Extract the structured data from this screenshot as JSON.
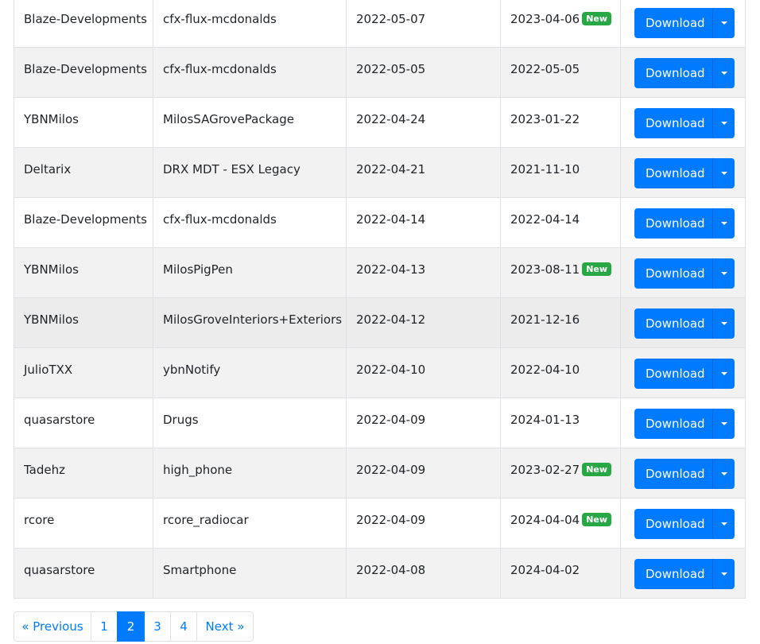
{
  "rows": [
    {
      "author": "Blaze-Developments",
      "name": "cfx-flux-mcdonalds",
      "created": "2022-05-07",
      "updated": "2023-04-06",
      "is_new": true
    },
    {
      "author": "Blaze-Developments",
      "name": "cfx-flux-mcdonalds",
      "created": "2022-05-05",
      "updated": "2022-05-05",
      "is_new": false
    },
    {
      "author": "YBNMilos",
      "name": "MilosSAGrovePackage",
      "created": "2022-04-24",
      "updated": "2023-01-22",
      "is_new": false
    },
    {
      "author": "Deltarix",
      "name": "DRX MDT - ESX Legacy",
      "created": "2022-04-21",
      "updated": "2021-11-10",
      "is_new": false
    },
    {
      "author": "Blaze-Developments",
      "name": "cfx-flux-mcdonalds",
      "created": "2022-04-14",
      "updated": "2022-04-14",
      "is_new": false
    },
    {
      "author": "YBNMilos",
      "name": "MilosPigPen",
      "created": "2022-04-13",
      "updated": "2023-08-11",
      "is_new": true
    },
    {
      "author": "YBNMilos",
      "name": "MilosGroveInteriors+Exteriors",
      "created": "2022-04-12",
      "updated": "2021-12-16",
      "is_new": false
    },
    {
      "author": "JulioTXX",
      "name": "ybnNotify",
      "created": "2022-04-10",
      "updated": "2022-04-10",
      "is_new": false
    },
    {
      "author": "quasarstore",
      "name": "Drugs",
      "created": "2022-04-09",
      "updated": "2024-01-13",
      "is_new": false
    },
    {
      "author": "Tadehz",
      "name": "high_phone",
      "created": "2022-04-09",
      "updated": "2023-02-27",
      "is_new": true
    },
    {
      "author": "rcore",
      "name": "rcore_radiocar",
      "created": "2022-04-09",
      "updated": "2024-04-04",
      "is_new": true
    },
    {
      "author": "quasarstore",
      "name": "Smartphone",
      "created": "2022-04-08",
      "updated": "2024-04-02",
      "is_new": false
    }
  ],
  "labels": {
    "download_button": "Download",
    "new_badge": "New"
  },
  "pagination": {
    "previous": "« Previous",
    "pages": [
      "1",
      "2",
      "3",
      "4"
    ],
    "current": "2",
    "next": "Next »"
  },
  "colors": {
    "primary": "#007bff",
    "badge_new": "#28a745",
    "stripe": "#f2f2f2"
  }
}
